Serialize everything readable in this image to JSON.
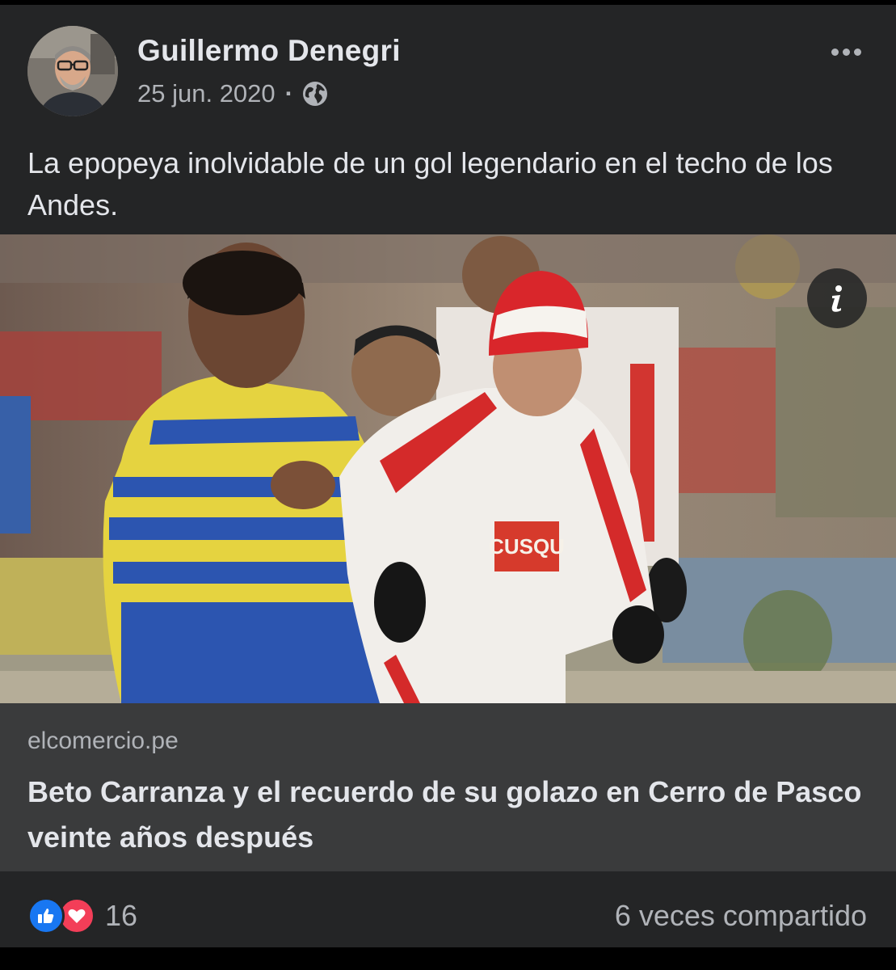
{
  "post": {
    "author_name": "Guillermo Denegri",
    "date": "25 jun. 2020",
    "separator": "·",
    "privacy_icon": "globe-icon",
    "text": "La epopeya inolvidable de un gol legendario en el techo de los Andes."
  },
  "link_preview": {
    "domain": "elcomercio.pe",
    "title": "Beto Carranza y el recuerdo de su golazo en Cerro de Pasco veinte años después",
    "image_description_icon": "info-icon",
    "image_text": "CUSQU"
  },
  "footer": {
    "reaction_icons": [
      "like-icon",
      "love-icon"
    ],
    "reaction_count": "16",
    "shares_text": "6 veces compartido"
  },
  "colors": {
    "background": "#242526",
    "caption_bg": "#3a3b3c",
    "primary_text": "#e4e6eb",
    "secondary_text": "#b0b3b8",
    "like_blue": "#1877f2",
    "love_red": "#f33e58"
  }
}
